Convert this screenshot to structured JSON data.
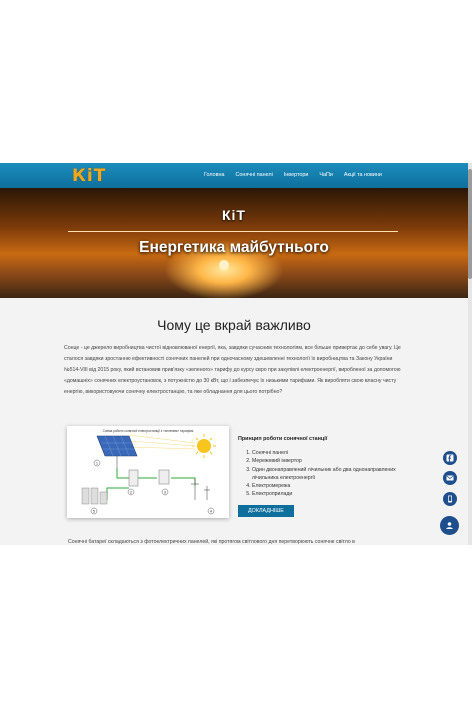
{
  "nav": {
    "logo": "КiТ",
    "items": [
      "Головна",
      "Сонячні панелі",
      "Інвертори",
      "ЧаПи",
      "Акції та новини"
    ]
  },
  "hero": {
    "title": "КiТ",
    "subtitle": "Енергетика майбутнього"
  },
  "main": {
    "heading": "Чому це вкрай важливо",
    "paragraph": "Сонце - це джерело виробництва чистої відновлюваної енергії, яка, завдяки сучасним технологіям, все більше привертає до себе увагу. Це сталося завдяки зростанню ефективності сонячних панелей при одночасному здешевленні технології їх виробництва та Закону України №514-VIII від 2015 року, який встановив прив'язку «зеленого» тарифу до курсу євро при закупівлі електроенергії, виробленої за допомогою «домашніх» сонячних електроустановок, з потужністю до 30 кВт, що і забезпечує їх низькими тарифами. Як виробляти свою власну чисту енергію, використовуючи сонячну електростанцію, та яке обладнання для цього потрібно?",
    "diagram_caption": "Схема роботи сонячної електростанції з «зеленим» тарифом",
    "diagram_labels": [
      "1",
      "2",
      "3",
      "4",
      "5"
    ],
    "info_title": "Принцип роботи сонячної станції",
    "list": [
      "Сонячні панелі",
      "Мережевий інвертор",
      "Один двонаправлений лічильник або два однонаправлених лічильника електроенергії",
      "Електромережа",
      "Електроприлади"
    ],
    "button": "ДОКЛАДНІШЕ",
    "bottom_text": "Сонячні батареї складаються з фотоелектричних панелей, які протягом світлового дня перетворюють сонячне світло в"
  },
  "floating": [
    "facebook-icon",
    "mail-icon",
    "phone-icon",
    "user-icon"
  ],
  "colors": {
    "nav": "#1583b4",
    "button": "#0e6f9c",
    "logo": "#f0a81e",
    "float": "#1e4e8c"
  }
}
